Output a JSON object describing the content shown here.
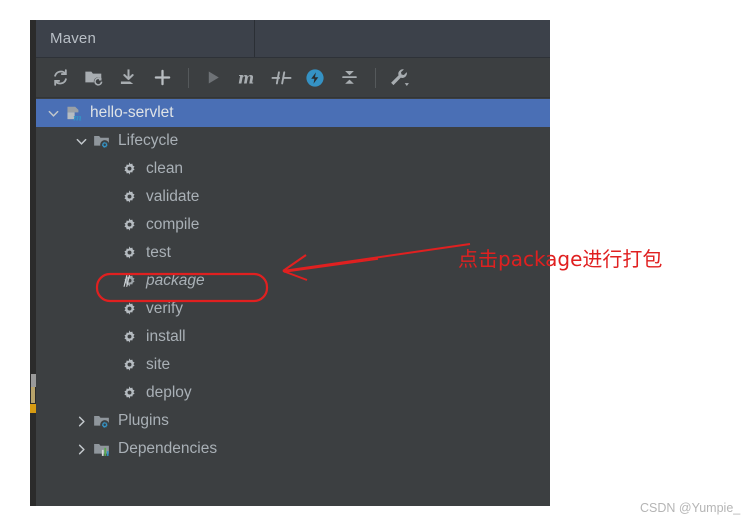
{
  "window": {
    "title": "Maven",
    "background_color": "#3c3f41",
    "header_color": "#3c414a",
    "selection_color": "#4a6fb5",
    "accent_color": "#3592c4",
    "annotation_color": "#e02020"
  },
  "header": {
    "tabs": [
      {
        "label": "Maven",
        "active": true
      }
    ]
  },
  "toolbar": {
    "buttons": [
      {
        "name": "reimport-icon",
        "tooltip": "Reload All Maven Projects"
      },
      {
        "name": "generate-sources-folder-icon",
        "tooltip": "Generate Sources and Update Folders"
      },
      {
        "name": "download-sources-icon",
        "tooltip": "Download Sources and/or Documentation"
      },
      {
        "name": "add-maven-project-icon",
        "tooltip": "Add Maven Projects"
      },
      {
        "name": "run-icon",
        "tooltip": "Run Maven Build"
      },
      {
        "name": "execute-maven-goal-icon",
        "tooltip": "Execute Maven Goal"
      },
      {
        "name": "toggle-offline-icon",
        "tooltip": "Toggle Offline Mode"
      },
      {
        "name": "toggle-skip-tests-icon",
        "tooltip": "Toggle 'Skip Tests' Mode"
      },
      {
        "name": "collapse-all-icon",
        "tooltip": "Collapse All"
      },
      {
        "name": "maven-settings-icon",
        "tooltip": "Maven Settings"
      }
    ],
    "separators_after": [
      3,
      8
    ]
  },
  "tree": {
    "rows": [
      {
        "label": "hello-servlet",
        "icon": "maven-module-icon",
        "indent": 0,
        "expander": "expanded",
        "selected": true,
        "italic": false
      },
      {
        "label": "Lifecycle",
        "icon": "lifecycle-folder-icon",
        "indent": 1,
        "expander": "expanded",
        "selected": false,
        "italic": false
      },
      {
        "label": "clean",
        "icon": "goal-gear-icon",
        "indent": 2,
        "expander": "none",
        "selected": false,
        "italic": false
      },
      {
        "label": "validate",
        "icon": "goal-gear-icon",
        "indent": 2,
        "expander": "none",
        "selected": false,
        "italic": false
      },
      {
        "label": "compile",
        "icon": "goal-gear-icon",
        "indent": 2,
        "expander": "none",
        "selected": false,
        "italic": false
      },
      {
        "label": "test",
        "icon": "goal-gear-icon",
        "indent": 2,
        "expander": "none",
        "selected": false,
        "italic": false
      },
      {
        "label": "package",
        "icon": "goal-gear-running-icon",
        "indent": 2,
        "expander": "none",
        "selected": false,
        "italic": true
      },
      {
        "label": "verify",
        "icon": "goal-gear-icon",
        "indent": 2,
        "expander": "none",
        "selected": false,
        "italic": false
      },
      {
        "label": "install",
        "icon": "goal-gear-icon",
        "indent": 2,
        "expander": "none",
        "selected": false,
        "italic": false
      },
      {
        "label": "site",
        "icon": "goal-gear-icon",
        "indent": 2,
        "expander": "none",
        "selected": false,
        "italic": false
      },
      {
        "label": "deploy",
        "icon": "goal-gear-icon",
        "indent": 2,
        "expander": "none",
        "selected": false,
        "italic": false
      },
      {
        "label": "Plugins",
        "icon": "plugins-folder-icon",
        "indent": 1,
        "expander": "collapsed",
        "selected": false,
        "italic": false
      },
      {
        "label": "Dependencies",
        "icon": "dependencies-icon",
        "indent": 1,
        "expander": "collapsed",
        "selected": false,
        "italic": false
      }
    ]
  },
  "annotation": {
    "text": "点击package进行打包",
    "color": "#e02020",
    "highlight_target": "package",
    "arrow": "left-pointing-arrow"
  },
  "watermark": {
    "text": "CSDN @Yumpie_"
  }
}
